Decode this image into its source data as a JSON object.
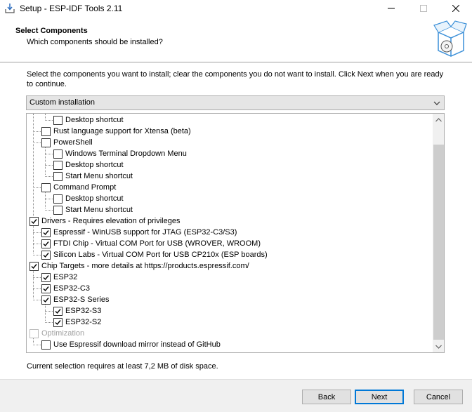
{
  "window": {
    "title": "Setup - ESP-IDF Tools 2.11"
  },
  "header": {
    "title": "Select Components",
    "subtitle": "Which components should be installed?"
  },
  "intro": "Select the components you want to install; clear the components you do not want to install. Click Next when you are ready to continue.",
  "install_type": {
    "selected": "Custom installation"
  },
  "components": [
    {
      "label": "Desktop shortcut",
      "level": 2,
      "checked": false,
      "disabled": false
    },
    {
      "label": "Rust language support for Xtensa (beta)",
      "level": 1,
      "checked": false,
      "disabled": false
    },
    {
      "label": "PowerShell",
      "level": 1,
      "checked": false,
      "disabled": false
    },
    {
      "label": "Windows Terminal Dropdown Menu",
      "level": 2,
      "checked": false,
      "disabled": false
    },
    {
      "label": "Desktop shortcut",
      "level": 2,
      "checked": false,
      "disabled": false
    },
    {
      "label": "Start Menu shortcut",
      "level": 2,
      "checked": false,
      "disabled": false
    },
    {
      "label": "Command Prompt",
      "level": 1,
      "checked": false,
      "disabled": false
    },
    {
      "label": "Desktop shortcut",
      "level": 2,
      "checked": false,
      "disabled": false
    },
    {
      "label": "Start Menu shortcut",
      "level": 2,
      "checked": false,
      "disabled": false
    },
    {
      "label": "Drivers - Requires elevation of privileges",
      "level": 0,
      "checked": true,
      "disabled": false
    },
    {
      "label": "Espressif - WinUSB support for JTAG (ESP32-C3/S3)",
      "level": 1,
      "checked": true,
      "disabled": false
    },
    {
      "label": "FTDI Chip - Virtual COM Port for USB (WROVER, WROOM)",
      "level": 1,
      "checked": true,
      "disabled": false
    },
    {
      "label": "Silicon Labs - Virtual COM Port for USB CP210x (ESP boards)",
      "level": 1,
      "checked": true,
      "disabled": false
    },
    {
      "label": "Chip Targets - more details at https://products.espressif.com/",
      "level": 0,
      "checked": true,
      "disabled": false
    },
    {
      "label": "ESP32",
      "level": 1,
      "checked": true,
      "disabled": false
    },
    {
      "label": "ESP32-C3",
      "level": 1,
      "checked": true,
      "disabled": false
    },
    {
      "label": "ESP32-S Series",
      "level": 1,
      "checked": true,
      "disabled": false
    },
    {
      "label": "ESP32-S3",
      "level": 2,
      "checked": true,
      "disabled": false
    },
    {
      "label": "ESP32-S2",
      "level": 2,
      "checked": true,
      "disabled": false
    },
    {
      "label": "Optimization",
      "level": 0,
      "checked": false,
      "disabled": true
    },
    {
      "label": "Use Espressif download mirror instead of GitHub",
      "level": 1,
      "checked": false,
      "disabled": false
    }
  ],
  "disk_space": "Current selection requires at least 7,2 MB of disk space.",
  "buttons": {
    "back": "Back",
    "next": "Next",
    "cancel": "Cancel"
  }
}
